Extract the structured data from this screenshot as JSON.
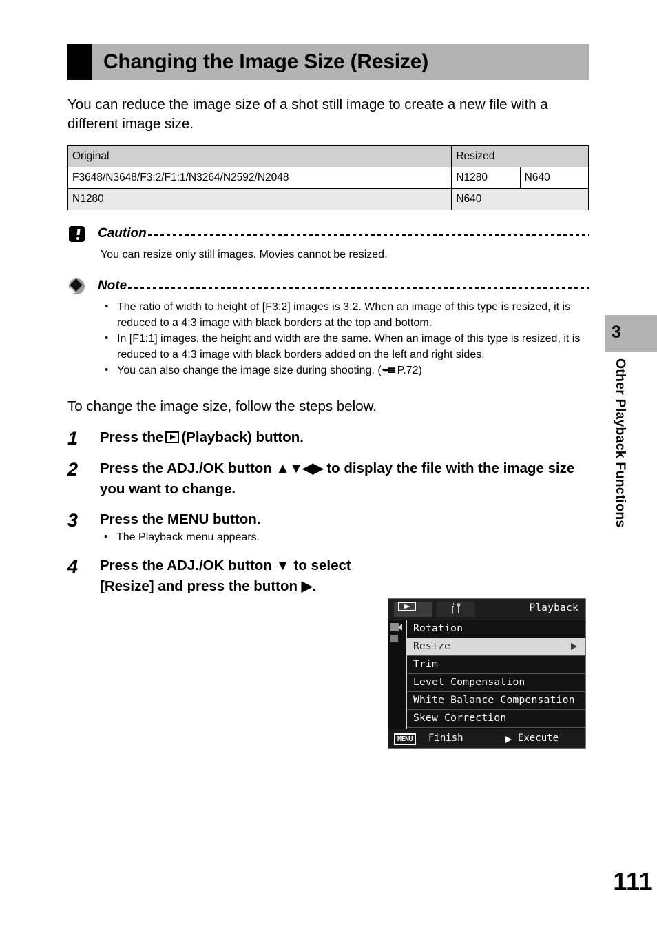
{
  "header": {
    "title": "Changing the Image Size (Resize)"
  },
  "intro": "You can reduce the image size of a shot still image to create a new file with a different image size.",
  "size_table": {
    "headers": [
      "Original",
      "Resized"
    ],
    "rows": [
      [
        "F3648/N3648/F3:2/F1:1/N3264/N2592/N2048",
        "N1280",
        "N640"
      ],
      [
        "N1280",
        "N640"
      ]
    ]
  },
  "caution": {
    "label": "Caution",
    "body": "You can resize only still images. Movies cannot be resized."
  },
  "note": {
    "label": "Note",
    "bullets": [
      "The ratio of width to height of [F3:2] images is 3:2. When an image of this type is resized, it is reduced to a 4:3 image with black borders at the top and bottom.",
      "In [F1:1] images, the height and width are the same. When an image of this type is resized, it is reduced to a 4:3 image with black borders added on the left and right sides.",
      "You can also change the image size during shooting. ("
    ],
    "bullet3_ref": "P.72)"
  },
  "leadin": "To change the image size, follow the steps below.",
  "steps": [
    {
      "num": "1",
      "text_before": "Press the",
      "text_after": "(Playback) button."
    },
    {
      "num": "2",
      "text_before": "Press the ADJ./OK button",
      "arrows": "▲▼◀▶",
      "text_after": "to display the file with the image size you want to change."
    },
    {
      "num": "3",
      "text": "Press the MENU button.",
      "sub": [
        "The Playback menu appears."
      ]
    },
    {
      "num": "4",
      "text_before": "Press the ADJ./OK button",
      "arrow_down": "▼",
      "text_mid": "to select [Resize] and press the button",
      "arrow_right": "▶",
      "text_after": "."
    }
  ],
  "lcd": {
    "title": "Playback",
    "tabs": [
      "playback-tab",
      "setup-tab"
    ],
    "menu_items": [
      {
        "label": "Rotation",
        "selected": false,
        "has_submenu": false
      },
      {
        "label": "Resize",
        "selected": true,
        "has_submenu": true
      },
      {
        "label": "Trim",
        "selected": false,
        "has_submenu": false
      },
      {
        "label": "Level Compensation",
        "selected": false,
        "has_submenu": false
      },
      {
        "label": "White Balance Compensation",
        "selected": false,
        "has_submenu": false
      },
      {
        "label": "Skew Correction",
        "selected": false,
        "has_submenu": false
      }
    ],
    "footer": {
      "menu_key": "MENU",
      "finish_label": "Finish",
      "execute_label": "Execute"
    }
  },
  "chapter": {
    "number": "3",
    "title": "Other Playback Functions"
  },
  "page_number": "111",
  "colors": {
    "header_bg": "#b3b3b3",
    "table_head_bg": "#cfcfcf",
    "table_alt_bg": "#e9e9e9",
    "lcd_bg": "#0e0e0e",
    "lcd_selected_bg": "#d9d9d9"
  }
}
